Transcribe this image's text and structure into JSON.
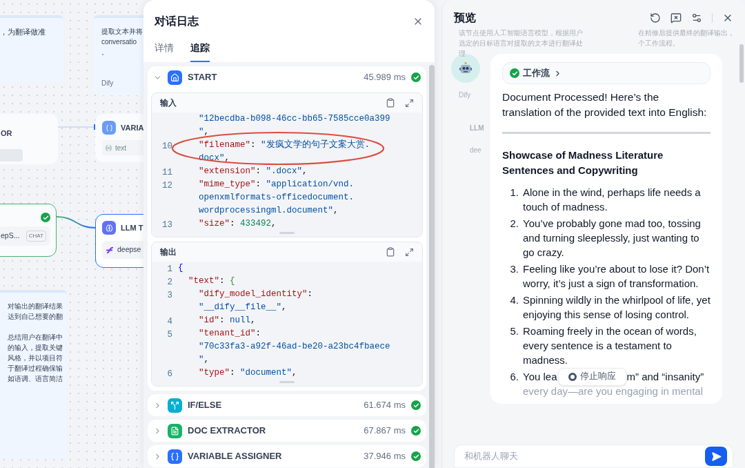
{
  "canvas": {
    "notes": [
      {
        "lines": [
          "，为翻译做准"
        ]
      },
      {
        "lines": [
          "提取文本并将",
          "conversatio",
          "。"
        ],
        "footer": "Dify"
      },
      {
        "lines": [
          "对输出的翻译结果",
          "达到自己想要的翻"
        ],
        "more_lines": [
          "总结用户在翻译中",
          "的输入，提取关键",
          "风格，并以项目符",
          "于翻译过程确保输",
          "如语调、语言简洁"
        ]
      }
    ],
    "nodes": [
      {
        "kind": "plain",
        "title": "OR",
        "succeeded": false,
        "selected": false
      },
      {
        "kind": "variable",
        "title": "VARIA",
        "tag": "text",
        "succeeded": false,
        "selected": false
      },
      {
        "kind": "model",
        "model": "epS...",
        "badge": "CHAT",
        "succeeded": true,
        "selected": false
      },
      {
        "kind": "llm",
        "title": "LLM T",
        "model": "deepse",
        "succeeded": false,
        "selected": true
      }
    ]
  },
  "log": {
    "title": "对话日志",
    "tabs": [
      {
        "label": "详情",
        "selected": false
      },
      {
        "label": "追踪",
        "selected": true
      }
    ],
    "steps": [
      {
        "kind": "start",
        "name": "START",
        "time": "45.989 ms",
        "succeeded": true,
        "expanded": true,
        "input": {
          "label": "输入",
          "lines": [
            {
              "parts": [
                {
                  "kind": "string",
                  "t": "    \"12becdba-b098-46cc-bb65-7585cce0a399"
                }
              ]
            },
            {
              "parts": [
                {
                  "kind": "string",
                  "t": "    \""
                },
                {
                  "kind": "punct",
                  "t": ","
                }
              ]
            },
            {
              "n": "10",
              "parts": [
                {
                  "kind": "key",
                  "t": "    \"filename\""
                },
                {
                  "kind": "punct",
                  "t": ": "
                },
                {
                  "kind": "string",
                  "t": "\"发疯文学的句子文案大赏."
                }
              ]
            },
            {
              "parts": [
                {
                  "kind": "string",
                  "t": "    docx\""
                },
                {
                  "kind": "punct",
                  "t": ","
                }
              ]
            },
            {
              "n": "11",
              "parts": [
                {
                  "kind": "key",
                  "t": "    \"extension\""
                },
                {
                  "kind": "punct",
                  "t": ": "
                },
                {
                  "kind": "string",
                  "t": "\".docx\""
                },
                {
                  "kind": "punct",
                  "t": ","
                }
              ]
            },
            {
              "n": "12",
              "parts": [
                {
                  "kind": "key",
                  "t": "    \"mime_type\""
                },
                {
                  "kind": "punct",
                  "t": ": "
                },
                {
                  "kind": "string",
                  "t": "\"application/vnd."
                }
              ]
            },
            {
              "parts": [
                {
                  "kind": "string",
                  "t": "    openxmlformats-officedocument."
                }
              ]
            },
            {
              "parts": [
                {
                  "kind": "string",
                  "t": "    wordprocessingml.document\""
                },
                {
                  "kind": "punct",
                  "t": ","
                }
              ]
            },
            {
              "n": "13",
              "parts": [
                {
                  "kind": "key",
                  "t": "    \"size\""
                },
                {
                  "kind": "punct",
                  "t": ": "
                },
                {
                  "kind": "number",
                  "t": "433492"
                },
                {
                  "kind": "punct",
                  "t": ","
                }
              ]
            }
          ]
        },
        "output": {
          "label": "输出",
          "lines": [
            {
              "n": "1",
              "parts": [
                {
                  "kind": "brace",
                  "t": "{"
                }
              ]
            },
            {
              "n": "2",
              "parts": [
                {
                  "kind": "key",
                  "t": "  \"text\""
                },
                {
                  "kind": "punct",
                  "t": ": "
                },
                {
                  "kind": "brace2",
                  "t": "{"
                }
              ]
            },
            {
              "n": "3",
              "parts": [
                {
                  "kind": "key",
                  "t": "    \"dify_model_identity\""
                },
                {
                  "kind": "punct",
                  "t": ":"
                }
              ]
            },
            {
              "parts": [
                {
                  "kind": "string",
                  "t": "    \"__dify__file__\""
                },
                {
                  "kind": "punct",
                  "t": ","
                }
              ]
            },
            {
              "n": "4",
              "parts": [
                {
                  "kind": "key",
                  "t": "    \"id\""
                },
                {
                  "kind": "punct",
                  "t": ": "
                },
                {
                  "kind": "null",
                  "t": "null"
                },
                {
                  "kind": "punct",
                  "t": ","
                }
              ]
            },
            {
              "n": "5",
              "parts": [
                {
                  "kind": "key",
                  "t": "    \"tenant_id\""
                },
                {
                  "kind": "punct",
                  "t": ":"
                }
              ]
            },
            {
              "parts": [
                {
                  "kind": "string",
                  "t": "    \"70c33fa3-a92f-46ad-be20-a23bc4fbaece"
                }
              ]
            },
            {
              "parts": [
                {
                  "kind": "string",
                  "t": "    \""
                },
                {
                  "kind": "punct",
                  "t": ","
                }
              ]
            },
            {
              "n": "6",
              "parts": [
                {
                  "kind": "key",
                  "t": "    \"type\""
                },
                {
                  "kind": "punct",
                  "t": ": "
                },
                {
                  "kind": "string",
                  "t": "\"document\""
                },
                {
                  "kind": "punct",
                  "t": ","
                }
              ]
            }
          ]
        }
      },
      {
        "kind": "ifelse",
        "name": "IF/ELSE",
        "time": "61.674 ms",
        "succeeded": true,
        "expanded": false
      },
      {
        "kind": "doc",
        "name": "DOC EXTRACTOR",
        "time": "67.867 ms",
        "succeeded": true,
        "expanded": false
      },
      {
        "kind": "variable",
        "name": "VARIABLE ASSIGNER",
        "time": "37.946 ms",
        "succeeded": true,
        "expanded": false
      }
    ]
  },
  "preview": {
    "title": "预览",
    "backdrop": {
      "left_lines": [
        "该节点使用人工智能语言模型，根据用户",
        "选定的目标语言对提取的文本进行翻译处",
        "理"
      ],
      "right_lines": [
        "在精修后提供最终的翻译输出，",
        "个工作流程。"
      ],
      "label": "Dify",
      "node_title": "LLM",
      "node_model": "dee"
    },
    "message": {
      "workflow": {
        "label": "工作流",
        "succeeded": true
      },
      "intro": "Document Processed! Here’s the translation of the provided text into English:",
      "heading": "Showcase of Madness Literature Sentences and Copywriting",
      "items": [
        {
          "num": "1.",
          "text": "Alone in the wind, perhaps life needs a touch of madness."
        },
        {
          "num": "2.",
          "text": "You’ve probably gone mad too, tossing and turning sleeplessly, just wanting to go crazy."
        },
        {
          "num": "3.",
          "text": "Feeling like you’re about to lose it? Don’t worry, it’s just a sign of transformation."
        },
        {
          "num": "4.",
          "text": "Spinning wildly in the whirlpool of life, yet enjoying this sense of losing control."
        },
        {
          "num": "5.",
          "text": "Roaming freely in the ocean of words, every sentence is a testament to madness."
        }
      ],
      "last_item": {
        "num": "6.",
        "before": "You lea",
        "after": "m” and “insanity”",
        "next_line": "every day—are you engaging in mental"
      }
    },
    "stop_button": "停止响应",
    "input": {
      "placeholder": "和机器人聊天"
    }
  }
}
